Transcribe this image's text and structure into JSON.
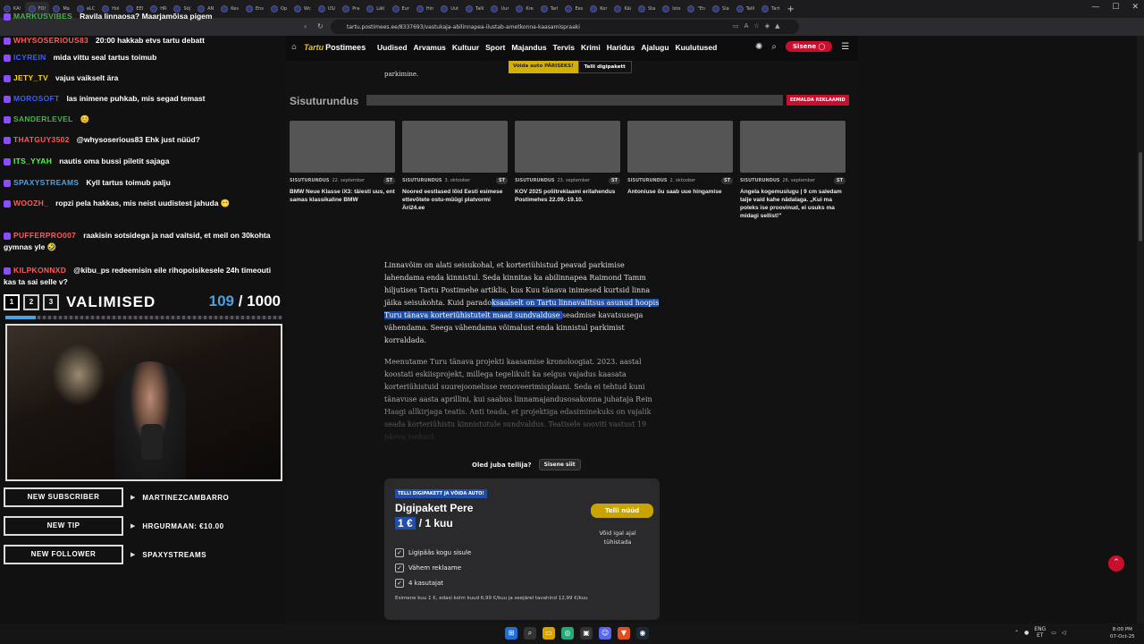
{
  "browser": {
    "tabs": [
      "KA!",
      "FO!",
      "Ma",
      "eLC",
      "Hol",
      "EEI",
      "HR",
      "Sõj",
      "AN",
      "Kes",
      "Ens",
      "Op",
      "Wc",
      "US/",
      "Pra",
      "Läti",
      "Eur",
      "Hin",
      "Uut",
      "Talli",
      "Uur",
      "Kre",
      "Tarl",
      "Ees",
      "Kor",
      "Käi",
      "Sta",
      "Isto",
      "\"En",
      "Sla",
      "Talli",
      "Tart"
    ],
    "url": "tartu.postimees.ee/8337693/vastukaja-abilinnapea-ilustab-ametkonna-kaasamispraaki",
    "new_tab_label": "+"
  },
  "site": {
    "home_icon": "home-icon",
    "logo_prefix": "Tartu",
    "logo_main": "Postimees",
    "nav": [
      "Uudised",
      "Arvamus",
      "Kultuur",
      "Sport",
      "Majandus",
      "Tervis",
      "Krimi",
      "Haridus",
      "Ajalugu",
      "Kuulutused"
    ],
    "login_label": "Sisene",
    "promo_a": "Võida auto PÄRISEKS!",
    "promo_b": "Telli digipakett",
    "intro_text": "parkimine."
  },
  "sponsored": {
    "heading": "Sisuturundus",
    "remove_label": "EEMALDA REKLAAMID",
    "cards": [
      {
        "tag": "SISUTURUNDUS",
        "date": "22. september",
        "badge": "ST",
        "title": "BMW Neue Klasse iX3: täiesti uus, ent samas klassikaline BMW"
      },
      {
        "tag": "SISUTURUNDUS",
        "date": "3. oktoober",
        "badge": "ST",
        "title": "Noored eestlased lõid Eesti esimese ettevõtete ostu-müügi platvormi Äri24.ee"
      },
      {
        "tag": "SISUTURUNDUS",
        "date": "23. september",
        "badge": "ST",
        "title": "KOV 2025 poliitreklaami erilahendus Postimehes 22.09.-19.10."
      },
      {
        "tag": "SISUTURUNDUS",
        "date": "2. oktoober",
        "badge": "ST",
        "title": "Antoniuse õu saab uue hingamise"
      },
      {
        "tag": "SISUTURUNDUS",
        "date": "26. september",
        "badge": "ST",
        "title": "Angela kogemuslugu | 9 cm saledam talje vaid kahe nädalaga. „Kui ma poleks ise proovinud, ei usuks ma midagi sellist!\""
      }
    ]
  },
  "article": {
    "p1_a": "Linnavõim on alati seisukohal, et korteriühistud peavad parkimise lahendama enda kinnistul. Seda kinnitas ka abilinnapea Raimond Tamm hiljutises Tartu Postimehe artiklis, kus Kuu tänava inimesed kurtsid linna jäika seisukohta. Kuid parado",
    "p1_hl": "ksaalselt on Tartu linnavalitsus asunud hoopis Turu tänava korteriühistutelt maad sundvalduse ",
    "p1_b": "seadmise kavatsusega vähendama. Seega vähendama võimalust enda kinnistul parkimist korraldada.",
    "p2": "Meenutame Turu tänava projekti kaasamise kronoloogiat. 2023. aastal koostati eskiisprojekt, millega tegelikult ka selgus vajadus kaasata korteriühistuid suurejoonelisse renoveerimisplaani. Seda ei tehtud kuni tänavuse aasta aprillini, kui saabus linnamajandusosakonna juhataja Rein Haagi allkirjaga teatis. Anti teada, et projektiga edasiminekuks on vajalik seada korteriühistu kinnistutule sundvaldus. Teatisele sooviti vastust 19 päeva jooksul."
  },
  "paywall": {
    "question": "Oled juba tellija?",
    "login_btn": "Sisene siit",
    "badge": "TELLI DIGIPAKETT JA VÕIDA AUTO!",
    "plan": "Digipakett Pere",
    "price": "1 €",
    "period": "/ 1 kuu",
    "order_btn": "Telli nüüd",
    "cancel_note": "Võid igal ajal tühistada",
    "features": [
      "Ligipääs kogu sisule",
      "Vähem reklaame",
      "4 kasutajat"
    ],
    "fine_print": "Esimene kuu 1 €, edasi kolm kuud 6,99 €/kuu ja seejärel tavahind 12,99 €/kuu"
  },
  "chat": [
    {
      "user": "MARKUSVIBES",
      "text": "Ravila linnaosa? Maarjamõisa pigem",
      "color": "#4caf50"
    },
    {
      "user": "WHYSOSERIOUS83",
      "text": "20:00 hakkab etvs tartu debatt",
      "color": "#ff5a5a"
    },
    {
      "user": "ICYREIN",
      "text": "mida vittu seal tartus toimub",
      "color": "#3a5cff"
    },
    {
      "user": "JETY_TV",
      "text": "vajus vaikselt ära",
      "color": "#ffd400"
    },
    {
      "user": "MOROSOFT",
      "text": "las inimene puhkab, mis segad temast",
      "color": "#3a5cff"
    },
    {
      "user": "SANDERLEVEL",
      "text": "😊",
      "color": "#4caf50"
    },
    {
      "user": "THATGUY3502",
      "text": "@whysoserious83 Ehk just nüüd?",
      "color": "#ff5a5a"
    },
    {
      "user": "ITS_YYAH",
      "text": "nautis oma bussi piletit sajaga",
      "color": "#4cff4c"
    },
    {
      "user": "SPAXYSTREAMS",
      "text": "Kyll tartus toimub palju",
      "color": "#4ea0e0"
    },
    {
      "user": "WOOZH_",
      "text": "ropzi pela hakkas, mis neist uudistest jahuda 😶",
      "color": "#ff5a5a"
    },
    {
      "user": "PUFFERPRO007",
      "text": "raakisin sotsidega ja nad vaitsid, et meil on 30kohta gymnas yle 🤣",
      "color": "#ff5a5a"
    },
    {
      "user": "KILPKONNXD",
      "text": "@kibu_ps redeemisin eile rihopoisikesele 24h timeouti kas ta sai selle v?",
      "color": "#ff5a5a"
    }
  ],
  "counter": {
    "tabs": [
      "1",
      "2",
      "3"
    ],
    "title": "VALIMISED",
    "current": "109",
    "total": "1000",
    "progress": 0.109
  },
  "alerts": [
    {
      "label": "NEW SUBSCRIBER",
      "name": "MARTINEZCAMBARRO"
    },
    {
      "label": "NEW TIP",
      "name": "HRGURMAAN: €10.00"
    },
    {
      "label": "NEW FOLLOWER",
      "name": "SPAXYSTREAMS"
    }
  ],
  "taskbar": {
    "lang": "ENG\nET",
    "time": "8:00 PM",
    "date": "07-Oct-25"
  },
  "colors": {
    "brand_red": "#c8102e",
    "brand_gold": "#c9a400",
    "highlight": "#1f4fa8"
  }
}
